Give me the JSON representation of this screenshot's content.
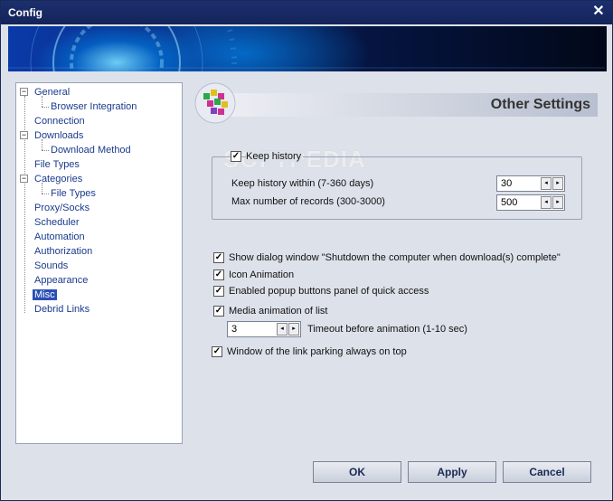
{
  "window": {
    "title": "Config",
    "close_glyph": "✕"
  },
  "tree": {
    "items": [
      {
        "label": "General",
        "expander": "−"
      },
      {
        "label": "Browser Integration"
      },
      {
        "label": "Connection"
      },
      {
        "label": "Downloads",
        "expander": "−"
      },
      {
        "label": "Download Method"
      },
      {
        "label": "File Types"
      },
      {
        "label": "Categories",
        "expander": "−"
      },
      {
        "label": "File Types"
      },
      {
        "label": "Proxy/Socks"
      },
      {
        "label": "Scheduler"
      },
      {
        "label": "Automation"
      },
      {
        "label": "Authorization"
      },
      {
        "label": "Sounds"
      },
      {
        "label": "Appearance"
      },
      {
        "label": "Misc",
        "selected": true
      },
      {
        "label": "Debrid Links"
      }
    ]
  },
  "header": {
    "title": "Other Settings"
  },
  "watermark": "SOFTPEDIA",
  "history": {
    "keep_history": {
      "label": "Keep history",
      "checked": true
    },
    "within": {
      "label": "Keep history within (7-360 days)",
      "value": "30"
    },
    "max_records": {
      "label": "Max number of records (300-3000)",
      "value": "500"
    }
  },
  "options": {
    "shutdown_dialog": {
      "label": "Show dialog window \"Shutdown the computer when download(s) complete\"",
      "checked": true
    },
    "icon_animation": {
      "label": "Icon Animation",
      "checked": true
    },
    "popup_panel": {
      "label": "Enabled popup buttons panel of quick access",
      "checked": true
    },
    "media_animation": {
      "label": "Media animation of list",
      "checked": true
    },
    "timeout": {
      "label": "Timeout before animation (1-10 sec)",
      "value": "3"
    },
    "link_parking": {
      "label": "Window of the link parking always on top",
      "checked": true
    }
  },
  "check_glyph": "✓",
  "spin": {
    "left": "◂",
    "right": "▸"
  },
  "buttons": {
    "ok": "OK",
    "apply": "Apply",
    "cancel": "Cancel"
  }
}
